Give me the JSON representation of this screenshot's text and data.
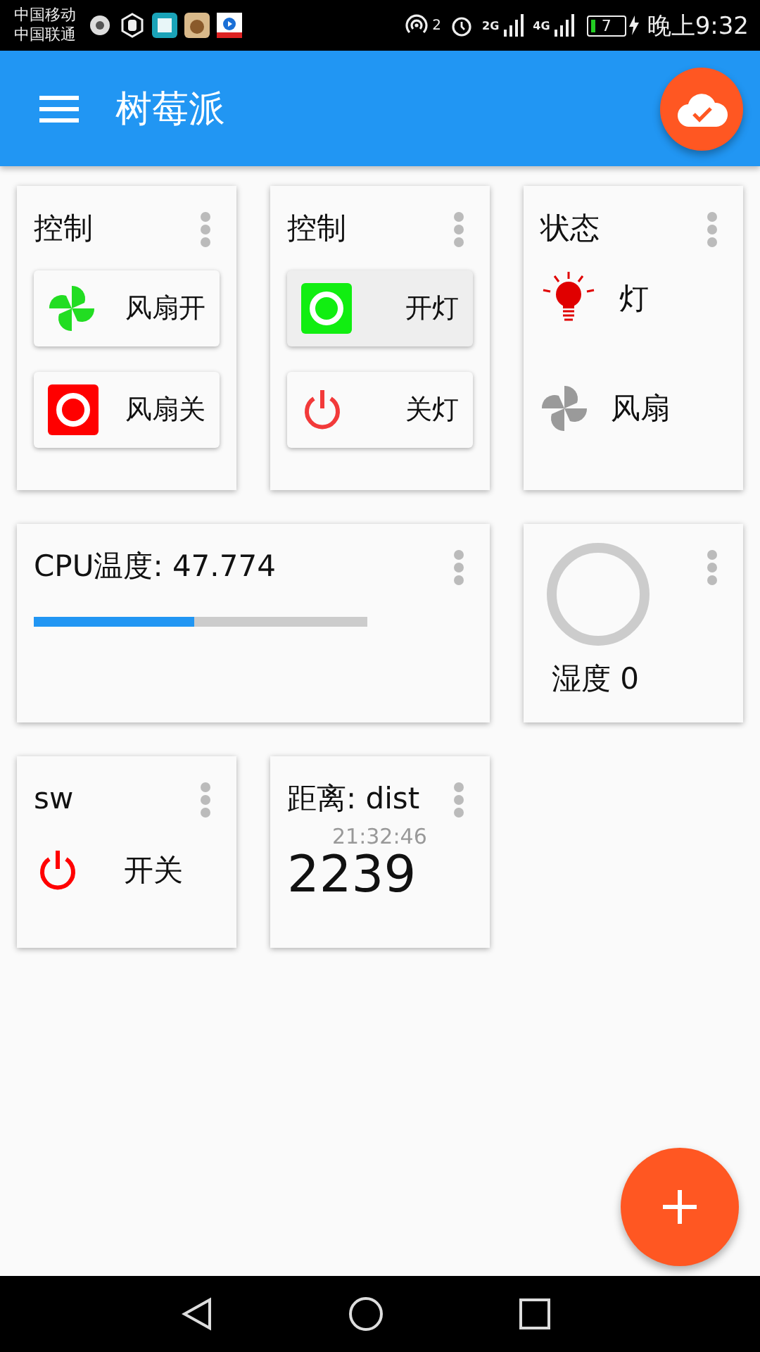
{
  "status_bar": {
    "carriers": [
      "中国移动",
      "中国联通"
    ],
    "hotspot_count": "2",
    "networks": [
      "2G",
      "4G"
    ],
    "battery": "7",
    "time": "晚上9:32"
  },
  "app_bar": {
    "title": "树莓派"
  },
  "cards": [
    {
      "kind": "buttons",
      "title": "控制",
      "buttons": [
        {
          "label": "风扇开",
          "active": false
        },
        {
          "label": "风扇关",
          "active": false
        }
      ]
    },
    {
      "kind": "buttons",
      "title": "控制",
      "buttons": [
        {
          "label": "开灯",
          "active": true
        },
        {
          "label": "关灯",
          "active": false
        }
      ]
    },
    {
      "kind": "status",
      "title": "状态",
      "items": [
        {
          "label": "灯",
          "on": true
        },
        {
          "label": "风扇",
          "on": false
        }
      ]
    },
    {
      "kind": "progress",
      "title": "CPU温度: 47.774",
      "level": 0.48
    },
    {
      "kind": "gauge",
      "label": "湿度 0"
    },
    {
      "kind": "switch",
      "title": "sw",
      "label": "开关"
    },
    {
      "kind": "value",
      "title": "距离: dist",
      "time": "21:32:46",
      "value": "2239"
    }
  ]
}
